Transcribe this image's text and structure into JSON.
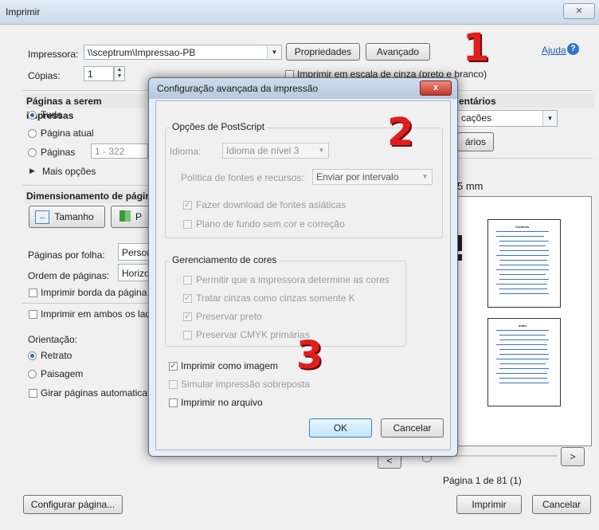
{
  "window": {
    "title": "Imprimir",
    "close_glyph": "✕"
  },
  "printer": {
    "label": "Impressora:",
    "value": "\\\\sceptrum\\Impressao-PB",
    "properties_label": "Propriedades",
    "advanced_label": "Avançado",
    "help_label": "Ajuda",
    "copies_label": "Cópias:",
    "copies_value": "1",
    "grayscale_label": "Imprimir em escala de cinza (preto e branco)"
  },
  "pages": {
    "heading": "Páginas a serem impressas",
    "all_label": "Tudo",
    "current_label": "Página atual",
    "pages_label": "Páginas",
    "pages_range": "1 - 322",
    "more_options_label": "Mais opções"
  },
  "sizing": {
    "heading": "Dimensionamento de págin",
    "size_button": "Tamanho",
    "second_button_fragment": "P",
    "pages_per_sheet_label": "Páginas por folha:",
    "pages_per_sheet_value": "Person",
    "page_order_label": "Ordem de páginas:",
    "page_order_value": "Horizo",
    "print_border_label": "Imprimir borda da página"
  },
  "duplex": {
    "label": "Imprimir em ambos os lad"
  },
  "orientation": {
    "label": "Orientação:",
    "portrait": "Retrato",
    "landscape": "Paisagem",
    "auto_rotate": "Girar páginas automaticam"
  },
  "comments": {
    "heading_fragment": "entários",
    "dropdown_value": "cações",
    "button_fragment": "ários"
  },
  "preview": {
    "size_fragment": "5 mm",
    "page_indicator": "Página 1 de 81 (1)",
    "page_heading_1": "Contents",
    "page_heading_2": "Index"
  },
  "footer": {
    "page_setup_label": "Configurar página...",
    "print_label": "Imprimir",
    "cancel_label": "Cancelar"
  },
  "markers": {
    "one": "1",
    "two": "2",
    "three": "3"
  },
  "advanced_dialog": {
    "title": "Configuração avançada da impressão",
    "close_glyph": "x",
    "postscript": {
      "heading": "Opções de PostScript",
      "language_label": "Idioma:",
      "language_value": "Idioma de nível 3",
      "font_policy_label": "Política de fontes e recursos:",
      "font_policy_value": "Enviar por intervalo",
      "download_asian_fonts": "Fazer download de fontes asiáticas",
      "no_color_background": "Plano de fundo sem cor e correção"
    },
    "color_management": {
      "heading": "Gerenciamento de cores",
      "printer_determines": "Permitir que a impressora determine as cores",
      "gray_as_k": "Tratar cinzas como cinzas somente K",
      "preserve_black": "Preservar preto",
      "preserve_cmyk": "Preservar CMYK primárias"
    },
    "print_as_image": "Imprimir como imagem",
    "simulate_overprint": "Simular impressão sobreposta",
    "print_to_file": "Imprimir no arquivo",
    "ok_label": "OK",
    "cancel_label": "Cancelar"
  },
  "colors": {
    "accent": "#2a63b8",
    "marker_red": "#e01e1e",
    "toc_blue": "#3b6fc8"
  },
  "icons": {
    "help": "question-circle-icon",
    "size": "resize-icon",
    "more": "triangle-right-icon"
  }
}
